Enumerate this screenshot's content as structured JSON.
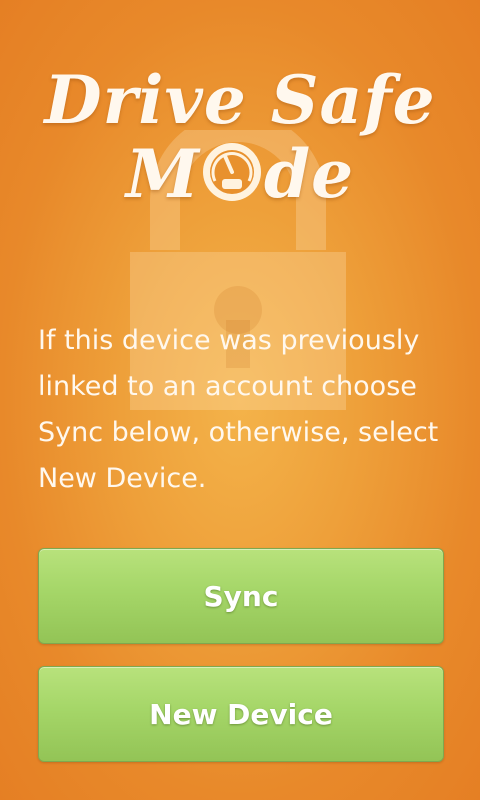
{
  "logo": {
    "line1": "Drive Safe",
    "line2_left": "M",
    "line2_right": "de"
  },
  "message": "If this device was previously linked to an account choose Sync below, otherwise, select New Device.",
  "buttons": {
    "sync_label": "Sync",
    "new_device_label": "New Device"
  },
  "colors": {
    "background": "#eea03a",
    "button_green": "#a5d668",
    "text": "#fff8ee"
  },
  "icons": {
    "background_lock": "lock-icon",
    "logo_gauge": "speedometer-icon"
  }
}
